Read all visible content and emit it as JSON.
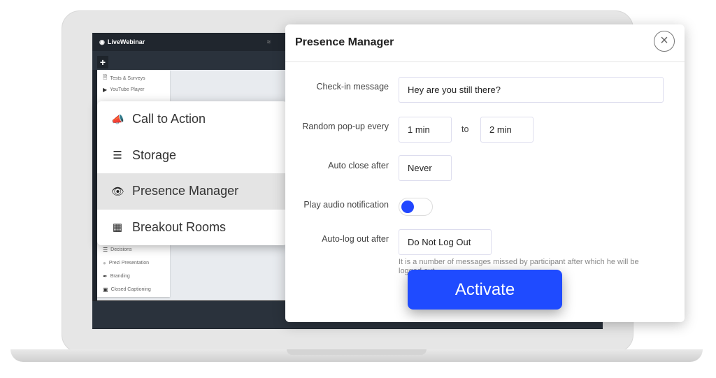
{
  "app": {
    "brand": "LiveWebinar",
    "add_label": "+"
  },
  "sidebar": {
    "items": [
      {
        "label": "Tests & Surveys",
        "icon": "document-icon"
      },
      {
        "label": "YouTube Player",
        "icon": "youtube-icon"
      },
      {
        "label": "Decisions",
        "icon": "list-icon"
      },
      {
        "label": "Prezi Presentation",
        "icon": "prezi-icon"
      },
      {
        "label": "Branding",
        "icon": "brush-icon"
      },
      {
        "label": "Closed Captioning",
        "icon": "cc-icon"
      }
    ]
  },
  "popup_menu": {
    "items": [
      {
        "label": "Call to Action",
        "icon": "megaphone-icon"
      },
      {
        "label": "Storage",
        "icon": "storage-icon"
      },
      {
        "label": "Presence Manager",
        "icon": "eye-icon",
        "selected": true
      },
      {
        "label": "Breakout Rooms",
        "icon": "grid-icon"
      }
    ]
  },
  "modal": {
    "title": "Presence Manager",
    "close": "×",
    "checkin_label": "Check-in message",
    "checkin_value": "Hey are you still there?",
    "random_label": "Random pop-up every",
    "random_from": "1 min",
    "random_to_label": "to",
    "random_to": "2 min",
    "autoclose_label": "Auto close after",
    "autoclose_value": "Never",
    "audio_label": "Play audio notification",
    "audio_enabled": true,
    "logout_label": "Auto-log out after",
    "logout_value": "Do Not Log Out",
    "help_line1": "It is a number of messages missed by participant after which he will be",
    "help_line2": "logged out.",
    "activate": "Activate"
  },
  "colors": {
    "accent": "#1f4bff",
    "dark": "#20262e"
  }
}
